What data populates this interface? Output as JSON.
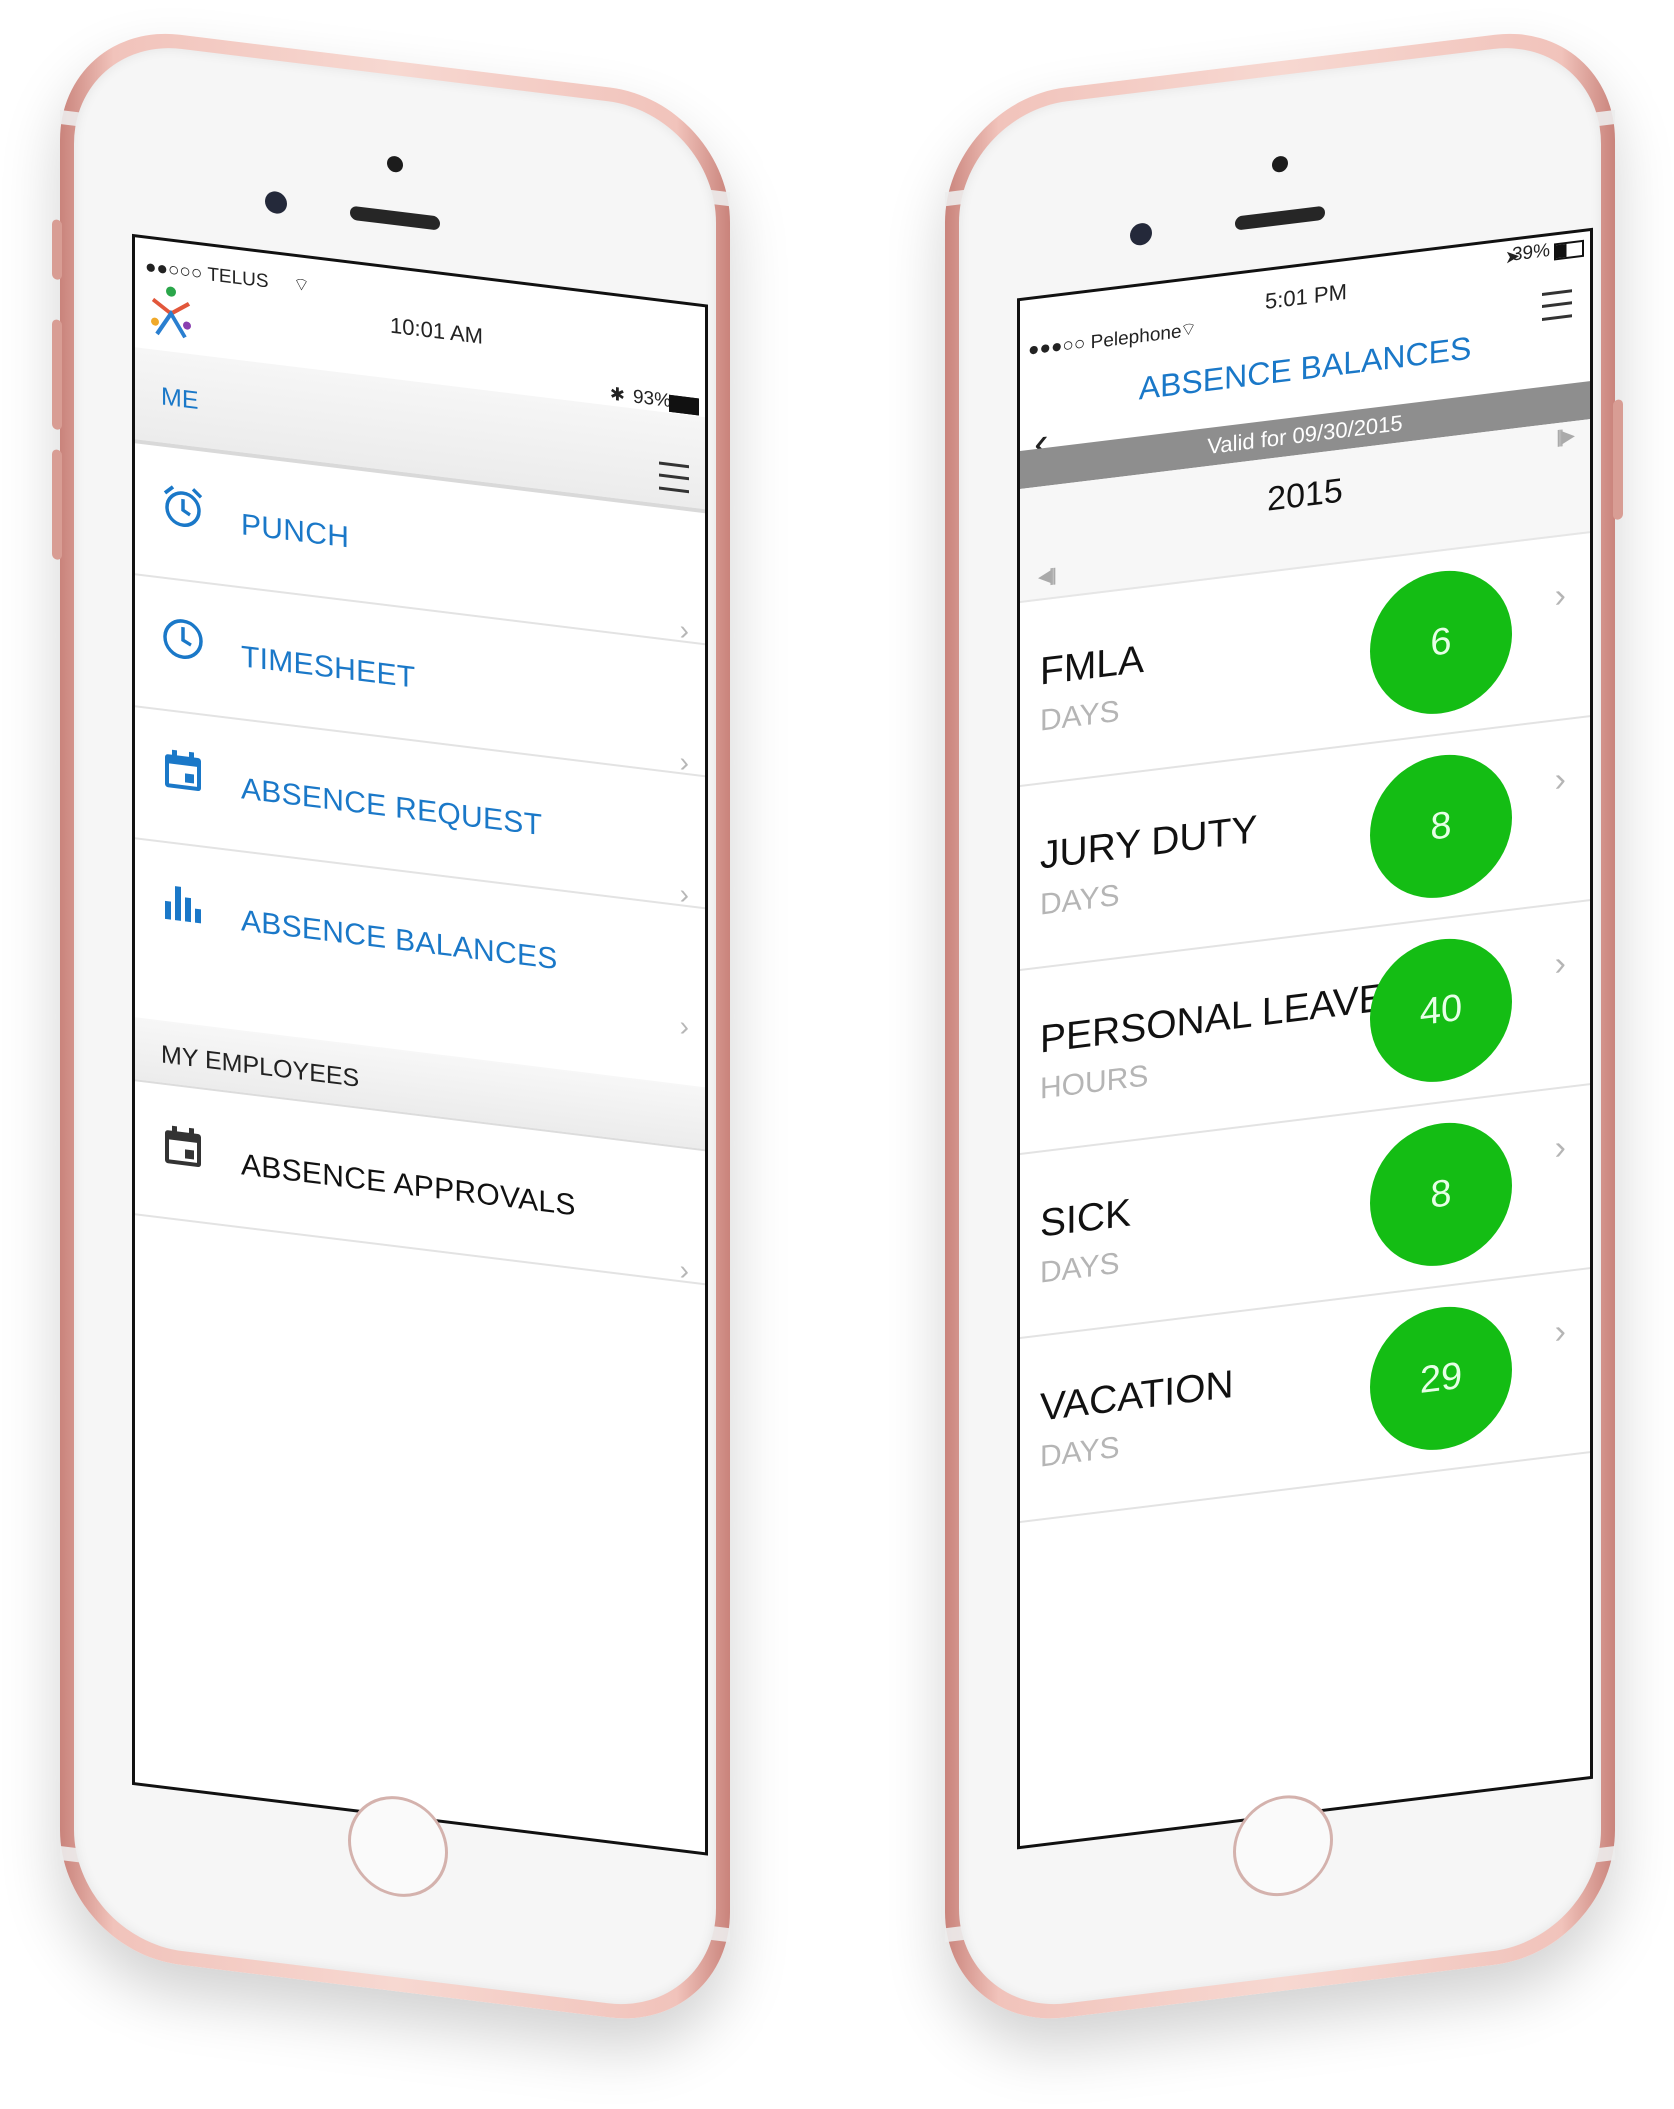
{
  "left_phone": {
    "status": {
      "carrier": "●●○○○ TELUS",
      "time": "10:01 AM",
      "battery": "93%"
    },
    "section_me": "ME",
    "menu": [
      {
        "label": "PUNCH",
        "icon": "alarm-clock-icon"
      },
      {
        "label": "TIMESHEET",
        "icon": "clock-icon"
      },
      {
        "label": "ABSENCE REQUEST",
        "icon": "calendar-icon"
      },
      {
        "label": "ABSENCE BALANCES",
        "icon": "bar-chart-icon"
      }
    ],
    "section_employees": "MY EMPLOYEES",
    "employee_menu": [
      {
        "label": "ABSENCE APPROVALS",
        "icon": "calendar-icon"
      }
    ]
  },
  "right_phone": {
    "status": {
      "carrier": "●●●○○ Pelephone",
      "time": "5:01 PM",
      "battery": "39%"
    },
    "title": "ABSENCE BALANCES",
    "valid_for": "Valid for 09/30/2015",
    "year": "2015",
    "balances": [
      {
        "name": "FMLA",
        "unit": "DAYS",
        "value": "6"
      },
      {
        "name": "JURY DUTY",
        "unit": "DAYS",
        "value": "8"
      },
      {
        "name": "PERSONAL LEAVE",
        "unit": "HOURS",
        "value": "40"
      },
      {
        "name": "SICK",
        "unit": "DAYS",
        "value": "8"
      },
      {
        "name": "VACATION",
        "unit": "DAYS",
        "value": "29"
      }
    ]
  },
  "colors": {
    "accent": "#1a78c8",
    "balance_circle": "#14bd14",
    "phone_rose_gold": "#f1c3bb"
  }
}
